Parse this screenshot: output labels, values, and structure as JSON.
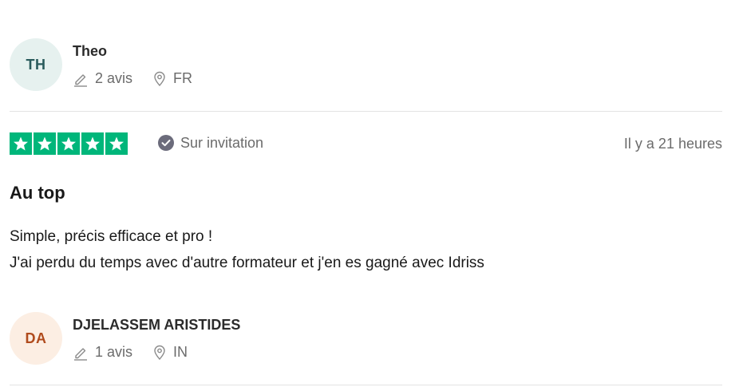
{
  "reviews": [
    {
      "initials": "TH",
      "name": "Theo",
      "review_count": "2 avis",
      "country": "FR",
      "rating": 5,
      "verified_label": "Sur invitation",
      "date": "Il y a 21 heures",
      "title": "Au top",
      "body_lines": [
        "Simple, précis efficace et pro !",
        "J'ai perdu du temps avec d'autre formateur et j'en es gagné avec Idriss"
      ]
    },
    {
      "initials": "DA",
      "name": "DJELASSEM ARISTIDES",
      "review_count": "1 avis",
      "country": "IN"
    }
  ],
  "icons": {
    "review_count": "pencil-icon",
    "country": "location-pin-icon",
    "verified": "check-circle-icon",
    "star": "star-icon"
  },
  "colors": {
    "star_green": "#00b67a",
    "avatar_teal_bg": "#e6f1ef",
    "avatar_peach_bg": "#fceee3",
    "muted_text": "#6b6b6b"
  }
}
